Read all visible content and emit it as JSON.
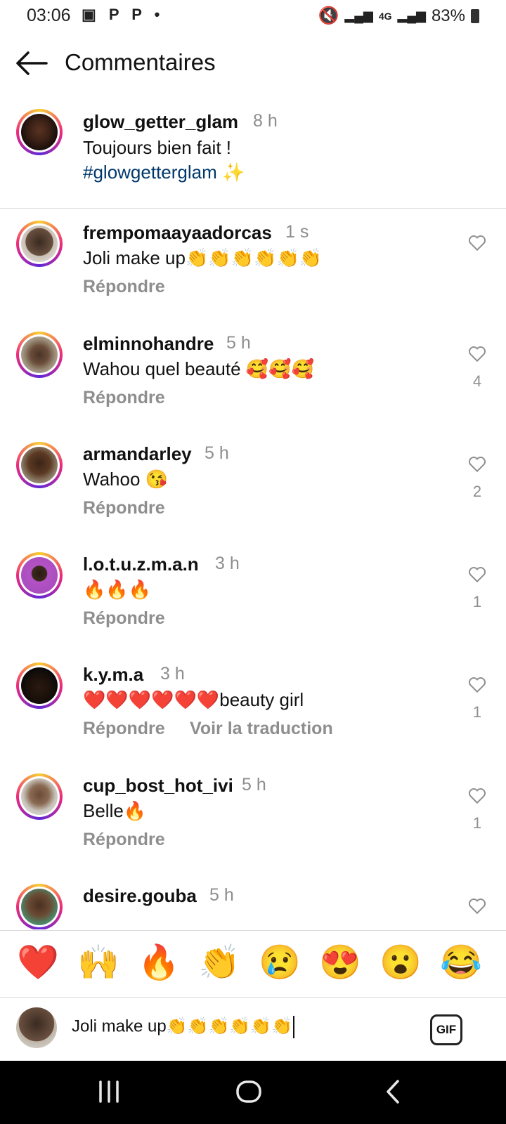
{
  "status": {
    "time": "03:06",
    "notif_icons": "▣ P P •",
    "net": "4G",
    "battery": "83%"
  },
  "header": {
    "title": "Commentaires"
  },
  "caption": {
    "username": "glow_getter_glam",
    "time": "8 h",
    "text": "Toujours bien fait !",
    "hashtag": "#glowgetterglam",
    "sparkle": "✨"
  },
  "comments": [
    {
      "username": "frempomaayaadorcas",
      "time": "1 s",
      "text": "Joli make up👏👏👏👏👏👏",
      "reply": "Répondre",
      "likes": ""
    },
    {
      "username": "elminnohandre",
      "time": "5 h",
      "text": "Wahou quel beauté 🥰🥰🥰",
      "reply": "Répondre",
      "likes": "4"
    },
    {
      "username": "armandarley",
      "time": "5 h",
      "text": "Wahoo 😘",
      "reply": "Répondre",
      "likes": "2"
    },
    {
      "username": "l.o.t.u.z.m.a.n",
      "time": "3 h",
      "text": "🔥🔥🔥",
      "reply": "Répondre",
      "likes": "1"
    },
    {
      "username": "k.y.m.a",
      "time": "3 h",
      "text": "❤️❤️❤️❤️❤️❤️beauty girl",
      "reply": "Répondre",
      "translate": "Voir la traduction",
      "likes": "1"
    },
    {
      "username": "cup_bost_hot_ivi",
      "time": "5 h",
      "text": "Belle🔥",
      "reply": "Répondre",
      "likes": "1"
    },
    {
      "username": "desire.gouba",
      "time": "5 h",
      "text": "",
      "reply": "",
      "likes": ""
    }
  ],
  "quick_emojis": [
    "❤️",
    "🙌",
    "🔥",
    "👏",
    "😢",
    "😍",
    "😮",
    "😂"
  ],
  "composer": {
    "value": "Joli make up👏👏👏👏👏👏",
    "gif_label": "GIF"
  },
  "colors": {
    "link": "#00376b",
    "muted": "#8e8e8e",
    "divider": "#dbdbdb"
  }
}
